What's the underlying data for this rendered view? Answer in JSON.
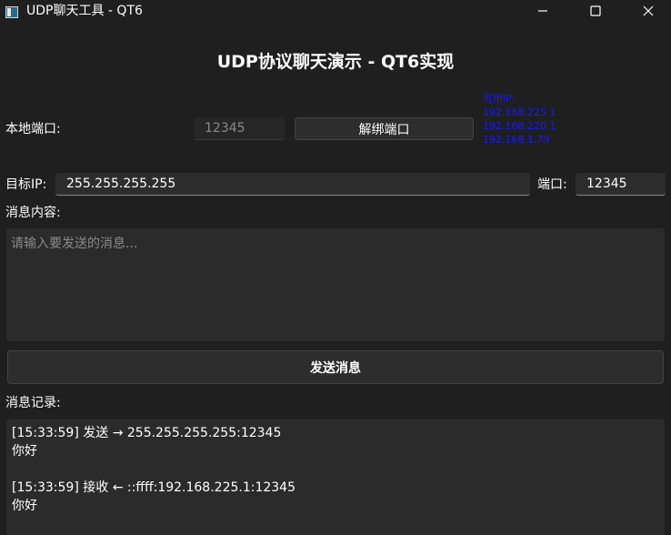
{
  "window": {
    "title": "UDP聊天工具 - QT6"
  },
  "heading": "UDP协议聊天演示 - QT6实现",
  "local_port": {
    "label": "本地端口:",
    "value": "12345",
    "unbind_button": "解绑端口"
  },
  "available_ips": {
    "label": "可用IP:",
    "items": [
      "192.168.225.1",
      "192.168.220.1",
      "192.168.1.79"
    ]
  },
  "target": {
    "ip_label": "目标IP:",
    "ip_value": "255.255.255.255",
    "port_label": "端口:",
    "port_value": "12345"
  },
  "message": {
    "label": "消息内容:",
    "placeholder": "请输入要发送的消息...",
    "send_button": "发送消息"
  },
  "log": {
    "label": "消息记录:",
    "entries": [
      {
        "header": "[15:33:59] 发送 → 255.255.255.255:12345",
        "text": "你好"
      },
      {
        "header": "[15:33:59] 接收 ← ::ffff:192.168.225.1:12345",
        "text": "你好"
      }
    ]
  },
  "colors": {
    "background": "#1f1f1f",
    "input_background": "#2d2d2d",
    "ip_list_text": "#1a1aff"
  }
}
